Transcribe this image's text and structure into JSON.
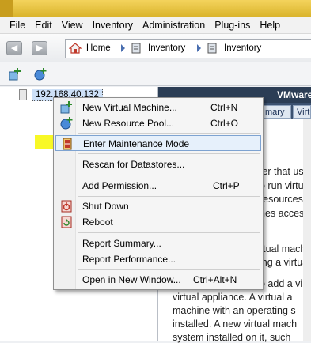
{
  "menubar": [
    "File",
    "Edit",
    "View",
    "Inventory",
    "Administration",
    "Plug-ins",
    "Help"
  ],
  "toolbar": {
    "back_icon": "back-arrow-icon",
    "forward_icon": "forward-arrow-icon",
    "breadcrumb": [
      "Home",
      "Inventory",
      "Inventory"
    ]
  },
  "tree": {
    "host": "192.168.40.132"
  },
  "right_pane": {
    "header": "VMware Es",
    "tabs": [
      "mary",
      "Virtua"
    ],
    "lines": [
      "ter that us",
      "o run virtua",
      "resources",
      "nes acces",
      "rtual mach",
      "ing a virtua",
      "o add a vir",
      "virtual appliance. A virtual a",
      "machine with an operating s",
      "installed. A new virtual mach",
      "system installed on it, such"
    ]
  },
  "context_menu": {
    "items": [
      {
        "label": "New Virtual Machine...",
        "shortcut": "Ctrl+N",
        "icon": "new-vm-icon"
      },
      {
        "label": "New Resource Pool...",
        "shortcut": "Ctrl+O",
        "icon": "resource-pool-icon"
      },
      {
        "label": "Enter Maintenance Mode",
        "shortcut": "",
        "icon": "maintenance-mode-icon"
      },
      {
        "label": "Rescan for Datastores...",
        "shortcut": "",
        "icon": ""
      },
      {
        "label": "Add Permission...",
        "shortcut": "Ctrl+P",
        "icon": ""
      },
      {
        "label": "Shut Down",
        "shortcut": "",
        "icon": "shutdown-icon"
      },
      {
        "label": "Reboot",
        "shortcut": "",
        "icon": "reboot-icon"
      },
      {
        "label": "Report Summary...",
        "shortcut": "",
        "icon": ""
      },
      {
        "label": "Report Performance...",
        "shortcut": "",
        "icon": ""
      },
      {
        "label": "Open in New Window...",
        "shortcut": "Ctrl+Alt+N",
        "icon": ""
      }
    ],
    "selected_item": "Enter Maintenance Mode",
    "highlight_color": "#f7f700"
  }
}
